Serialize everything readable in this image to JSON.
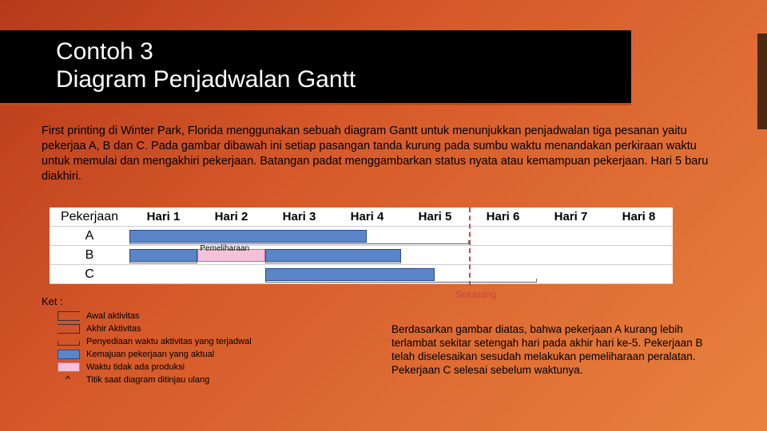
{
  "title_line1": "Contoh 3",
  "title_line2": "Diagram Penjadwalan Gantt",
  "intro": "First printing di Winter Park, Florida menggunakan sebuah diagram Gantt untuk menunjukkan penjadwalan tiga pesanan yaitu pekerjaa A, B dan C. Pada gambar dibawah ini setiap pasangan tanda kurung pada sumbu waktu menandakan perkiraan waktu untuk memulai dan mengakhiri pekerjaan. Batangan padat menggambarkan status nyata atau kemampuan pekerjaan. Hari 5 baru diakhiri.",
  "col_job": "Pekerjaan",
  "days": [
    "Hari 1",
    "Hari 2",
    "Hari 3",
    "Hari 4",
    "Hari 5",
    "Hari 6",
    "Hari 7",
    "Hari 8"
  ],
  "rows": [
    "A",
    "B",
    "C"
  ],
  "maint": "Pemeliharaan",
  "ket": "Ket :",
  "now": "Sekarang",
  "legend": {
    "start": "Awal aktivitas",
    "end": "Akhir Aktivitas",
    "scheduled": "Penyediaan waktu aktivitas yang terjadwal",
    "actual": "Kemajuan pekerjaan yang aktual",
    "noprod": "Waktu tidak ada produksi",
    "review": "Titik saat diagram ditinjau ulang"
  },
  "conclusion": "Berdasarkan gambar diatas, bahwa pekerjaan A kurang lebih terlambat sekitar setengah hari pada akhir hari ke-5. Pekerjaan B telah diselesaikan sesudah melakukan pemeliharaan peralatan. Pekerjaan C selesai sebelum waktunya.",
  "chart_data": {
    "type": "gantt",
    "time_unit": "day",
    "days": 8,
    "now": 5,
    "jobs": [
      {
        "name": "A",
        "scheduled_start": 1,
        "scheduled_end": 6,
        "actual_progress_end": 4.5
      },
      {
        "name": "B",
        "scheduled_start": 1,
        "scheduled_end": 2,
        "actual_progress_end": 2,
        "maintenance": {
          "start": 2,
          "end": 3
        },
        "scheduled2_start": 3,
        "scheduled2_end": 5,
        "actual2_end": 5
      },
      {
        "name": "C",
        "scheduled_start": 3,
        "scheduled_end": 7,
        "actual_progress_end": 5.5
      }
    ]
  }
}
